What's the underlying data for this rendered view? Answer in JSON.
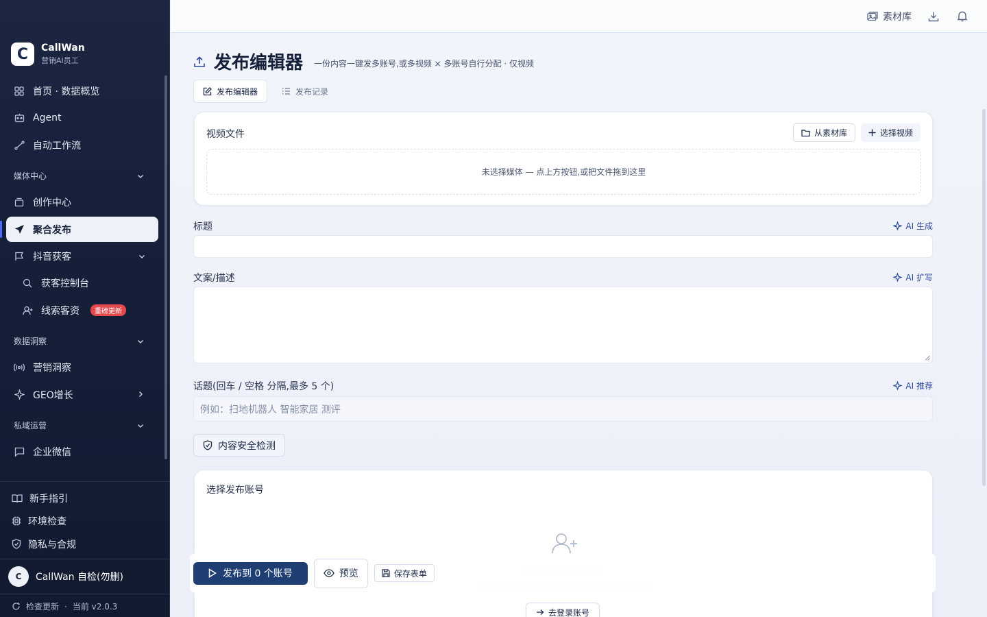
{
  "brand": {
    "logo_letter": "C",
    "name": "CallWan",
    "subtitle": "营销AI员工"
  },
  "sidebar": {
    "items": [
      {
        "label": "首页 · 数据概览",
        "icon": "grid-icon"
      },
      {
        "label": "Agent",
        "icon": "bot-icon"
      },
      {
        "label": "自动工作流",
        "icon": "workflow-icon"
      }
    ],
    "sections": [
      {
        "label": "媒体中心"
      },
      {
        "label": "数据洞察"
      },
      {
        "label": "私域运营"
      }
    ],
    "media": [
      {
        "label": "创作中心",
        "icon": "layers-icon"
      },
      {
        "label": "聚合发布",
        "icon": "send-icon"
      },
      {
        "label": "抖音获客",
        "icon": "flag-icon"
      },
      {
        "label": "获客控制台",
        "icon": "search-icon"
      },
      {
        "label": "线索客资",
        "icon": "user-add-icon",
        "badge": "重磅更新"
      }
    ],
    "insight": [
      {
        "label": "营销洞察",
        "icon": "broadcast-icon"
      },
      {
        "label": "GEO增长",
        "icon": "sparkle-icon"
      }
    ],
    "private": [
      {
        "label": "企业微信",
        "icon": "chat-icon"
      }
    ],
    "bottom": [
      {
        "label": "新手指引",
        "icon": "book-icon"
      },
      {
        "label": "环境检查",
        "icon": "chip-icon"
      },
      {
        "label": "隐私与合规",
        "icon": "shield-icon"
      }
    ],
    "user": {
      "avatar": "C",
      "name": "CallWan 自检(勿删)"
    },
    "version": {
      "update": "检查更新",
      "current": "当前 v2.0.3"
    }
  },
  "topbar": {
    "library": "素材库"
  },
  "page": {
    "title": "发布编辑器",
    "subtitle": "一份内容一键发多账号,或多视频 × 多账号自行分配 · 仅视频",
    "tabs": [
      "发布编辑器",
      "发布记录"
    ]
  },
  "video": {
    "title": "视频文件",
    "from_library": "从素材库",
    "select_video": "选择视频",
    "empty": "未选择媒体 — 点上方按钮,或把文件拖到这里"
  },
  "form": {
    "title_label": "标题",
    "title_ai": "AI 生成",
    "title_value": "",
    "desc_label": "文案/描述",
    "desc_ai": "AI 扩写",
    "desc_value": "",
    "topic_label": "话题(回车 / 空格 分隔,最多 5 个)",
    "topic_ai": "AI 推荐",
    "topic_placeholder": "例如：扫地机器人 智能家居 测评",
    "safety_check": "内容安全检测"
  },
  "accounts": {
    "title": "选择发布账号",
    "login_button": "去登录账号"
  },
  "actions": {
    "publish": "发布到 0 个账号",
    "preview": "预览",
    "save": "保存表单"
  }
}
